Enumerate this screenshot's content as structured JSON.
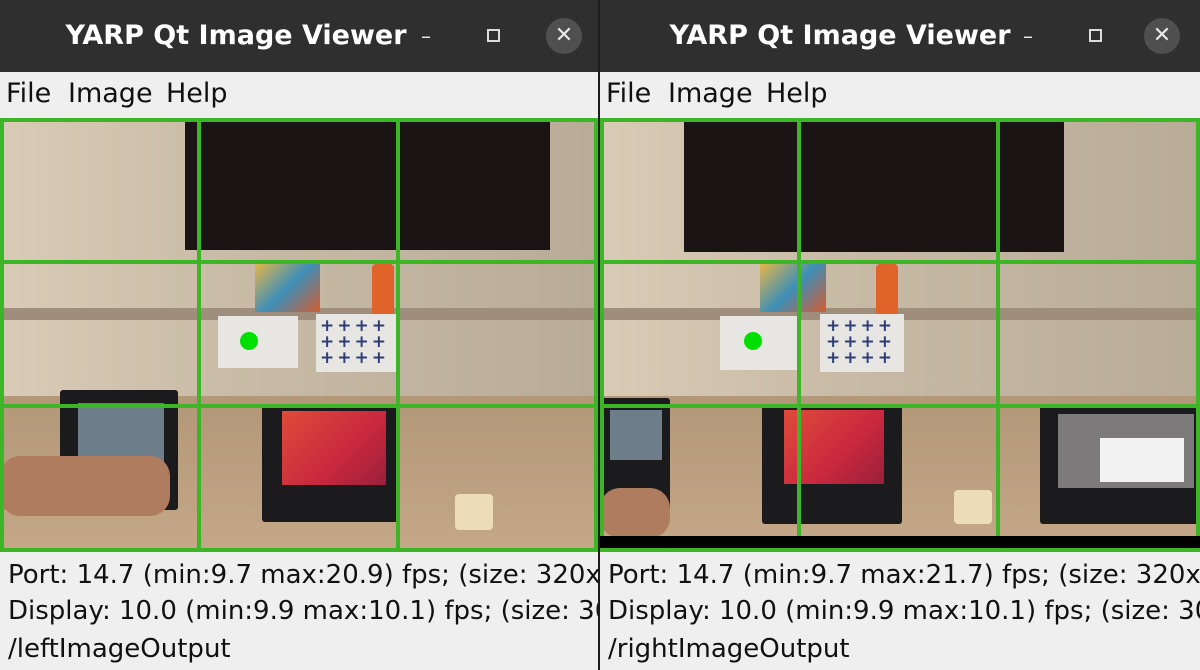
{
  "windows": [
    {
      "title": "YARP Qt Image Viewer",
      "menu": [
        "File",
        "Image",
        "Help"
      ],
      "controls": {
        "minimize": "–",
        "maximize_icon": "maximize-square",
        "close": "✕"
      },
      "port_stats": "Port: 14.7 (min:9.7 max:20.9) fps; (size: 320x",
      "display_stats": "Display: 10.0 (min:9.9 max:10.1) fps; (size: 30",
      "port_name": "/leftImageOutput"
    },
    {
      "title": "YARP Qt Image Viewer",
      "menu": [
        "File",
        "Image",
        "Help"
      ],
      "controls": {
        "minimize": "–",
        "maximize_icon": "maximize-square",
        "close": "✕"
      },
      "port_stats": "Port: 14.7 (min:9.7 max:21.7) fps; (size: 320x",
      "display_stats": "Display: 10.0 (min:9.9 max:10.1) fps; (size: 30",
      "port_name": "/rightImageOutput"
    }
  ],
  "colors": {
    "grid": "#3cb526",
    "marker": "#00e000",
    "titlebar": "#2f2f2f",
    "background": "#efefef"
  }
}
